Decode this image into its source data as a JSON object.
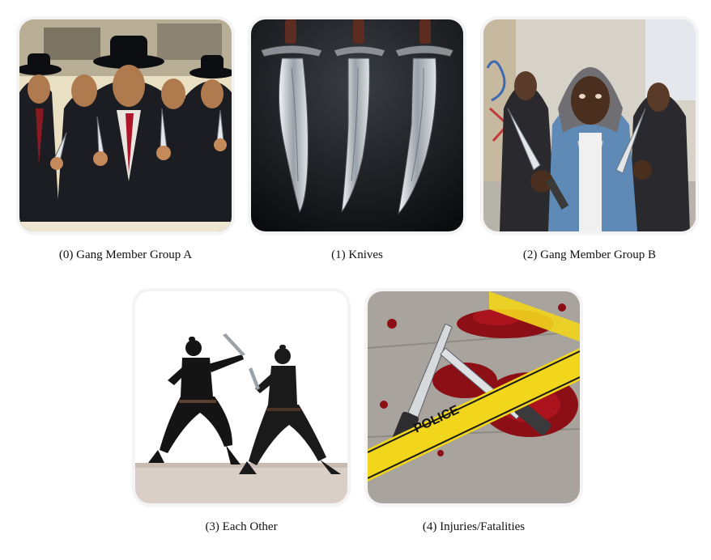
{
  "tiles": [
    {
      "caption": "(0) Gang Member Group A",
      "image_alt": "gang members in fedoras holding knives"
    },
    {
      "caption": "(1) Knives",
      "image_alt": "three ornate knives on dark background"
    },
    {
      "caption": "(2) Gang Member Group B",
      "image_alt": "three hooded men holding knives"
    },
    {
      "caption": "(3) Each Other",
      "image_alt": "two fighters dueling with blades"
    },
    {
      "caption": "(4) Injuries/Fatalities",
      "image_alt": "knives and blood behind police tape"
    }
  ],
  "police_tape_text": "POLICE"
}
